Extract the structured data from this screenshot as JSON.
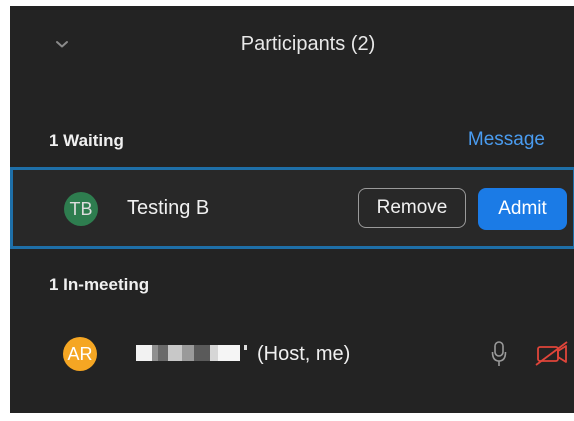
{
  "header": {
    "title": "Participants (2)",
    "collapse_icon": "chevron-down-icon"
  },
  "waiting": {
    "label": "1 Waiting",
    "message_label": "Message",
    "participant": {
      "initials": "TB",
      "name": "Testing B",
      "avatar_color": "#2e7d4f",
      "remove_label": "Remove",
      "admit_label": "Admit"
    }
  },
  "in_meeting": {
    "label": "1 In-meeting",
    "participant": {
      "initials": "AR",
      "name_suffix": " (Host, me)",
      "avatar_color": "#f5a623",
      "mic_icon": "microphone-icon",
      "video_icon": "video-off-icon"
    }
  },
  "colors": {
    "panel_bg": "#232323",
    "accent_blue": "#1b7be6",
    "link_blue": "#4a9cf0",
    "highlight_border": "#1e6fa8",
    "video_off_red": "#e0453a"
  }
}
